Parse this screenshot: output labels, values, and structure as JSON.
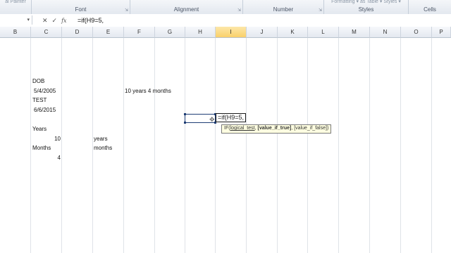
{
  "ribbon": {
    "groups": [
      {
        "label": "",
        "top": "al Painter"
      },
      {
        "label": "Font",
        "top": ""
      },
      {
        "label": "Alignment",
        "top": ""
      },
      {
        "label": "Number",
        "top": ""
      },
      {
        "label": "Styles",
        "top": "Formatting ▾  as Table ▾  Styles ▾"
      },
      {
        "label": "Cells",
        "top": ""
      }
    ]
  },
  "formula_bar": {
    "cancel": "✕",
    "enter": "✓",
    "fx": "fx",
    "formula": "=if(H9=5,"
  },
  "columns": [
    "B",
    "C",
    "D",
    "E",
    "F",
    "G",
    "H",
    "I",
    "J",
    "K",
    "L",
    "M",
    "N",
    "O",
    "P"
  ],
  "active_column": "I",
  "cells": {
    "c_dob": "DOB",
    "c_dob_val": "5/4/2005",
    "f_age": "10 years 4 months",
    "c_test": "TEST",
    "c_test_val": "6/6/2015",
    "c_years": "Years",
    "c_years_val": "10",
    "e_years": "years",
    "c_months": "Months",
    "e_months": "months",
    "c_months_val": "4"
  },
  "edit_text": "=if(H9=5,",
  "tooltip": {
    "fn": "IF(",
    "arg1": "logical_test",
    "sep1": ", ",
    "arg2": "[value_if_true]",
    "sep2": ", ",
    "arg3": "[value_if_false]",
    "close": ")"
  }
}
